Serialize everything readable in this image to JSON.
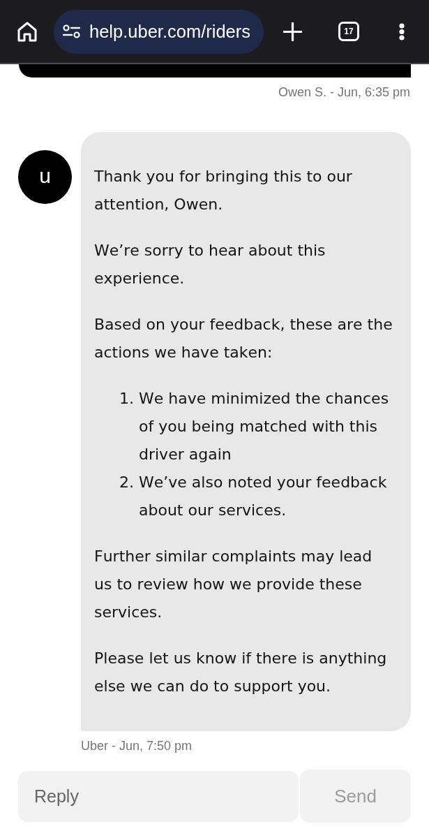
{
  "browser_bar": {
    "url": "help.uber.com/riders",
    "tab_count": "17"
  },
  "messages": [
    {
      "kind": "outgoing",
      "meta": "Owen S. - Jun, 6:35 pm"
    },
    {
      "kind": "incoming",
      "avatar_letter": "u",
      "blocks": [
        {
          "kind": "paragraph",
          "text": "Thank you for bringing this to our attention, Owen."
        },
        {
          "kind": "paragraph",
          "text": "We’re sorry to hear about this experience."
        },
        {
          "kind": "paragraph",
          "text": "Based on your feedback, these are the actions we have taken:"
        },
        {
          "kind": "list",
          "items": [
            {
              "number": "1.",
              "text": "We have minimized the chances of you being matched with this driver again"
            },
            {
              "number": "2.",
              "text": "We’ve also noted your feedback about our services."
            }
          ]
        },
        {
          "kind": "paragraph",
          "text": "Further similar complaints may lead us to review how we provide these services."
        },
        {
          "kind": "paragraph",
          "text": "Please let us know if there is anything else we can do to support you."
        }
      ],
      "meta": "Uber - Jun, 7:50 pm"
    }
  ],
  "composer": {
    "placeholder": "Reply",
    "send": {
      "label": "Send",
      "disabled": true
    }
  }
}
